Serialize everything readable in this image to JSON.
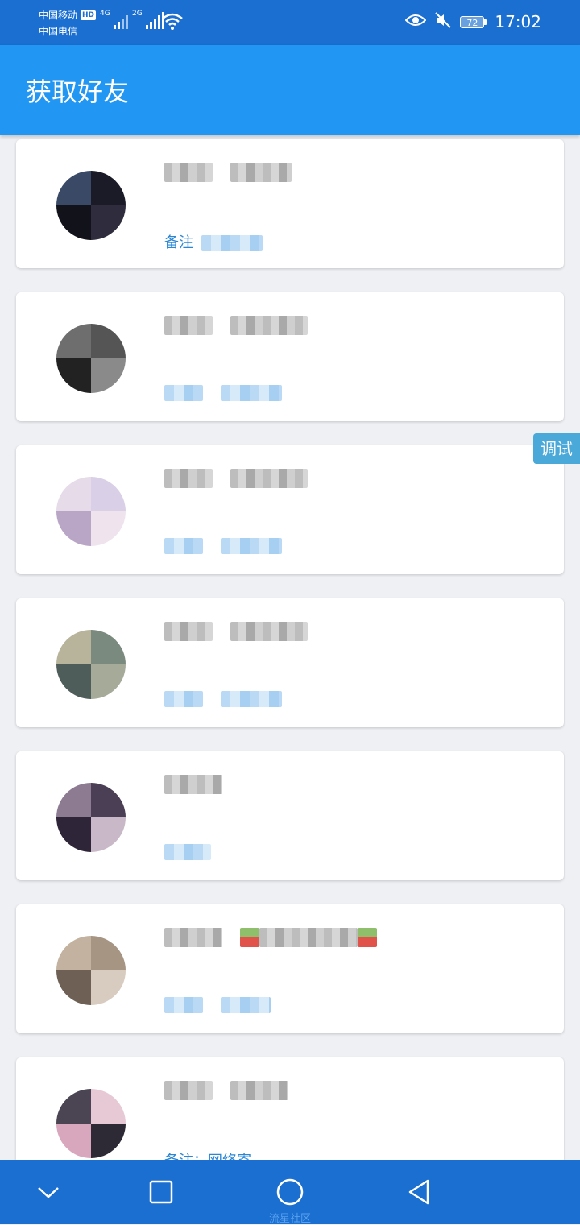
{
  "status_bar": {
    "carrier_1": "中国移动",
    "carrier_1_badge": "HD",
    "carrier_2": "中国电信",
    "signal_1_label": "4G",
    "signal_2_label": "2G",
    "battery_level": "72",
    "time": "17:02",
    "icons": [
      "eye-icon",
      "mute-icon",
      "wifi-icon",
      "battery-icon"
    ]
  },
  "app_bar": {
    "title": "获取好友"
  },
  "friends": [
    {
      "name": "",
      "remark": "备注"
    },
    {
      "name": "",
      "remark": ""
    },
    {
      "name": "",
      "remark": ""
    },
    {
      "name": "",
      "remark": ""
    },
    {
      "name": "",
      "remark": ""
    },
    {
      "name": "",
      "remark": ""
    },
    {
      "name": "",
      "remark": "备注：网络寄"
    }
  ],
  "debug_tab": {
    "label": "调试"
  },
  "nav_bar": {
    "icons": [
      "chevron-down-icon",
      "recents-square-icon",
      "home-circle-icon",
      "back-triangle-icon"
    ],
    "watermark": "流星社区"
  },
  "colors": {
    "status_bar": "#1a6fd0",
    "app_bar": "#2196f3",
    "page_bg": "#eef0f4",
    "remark_text": "#2b87d6"
  }
}
